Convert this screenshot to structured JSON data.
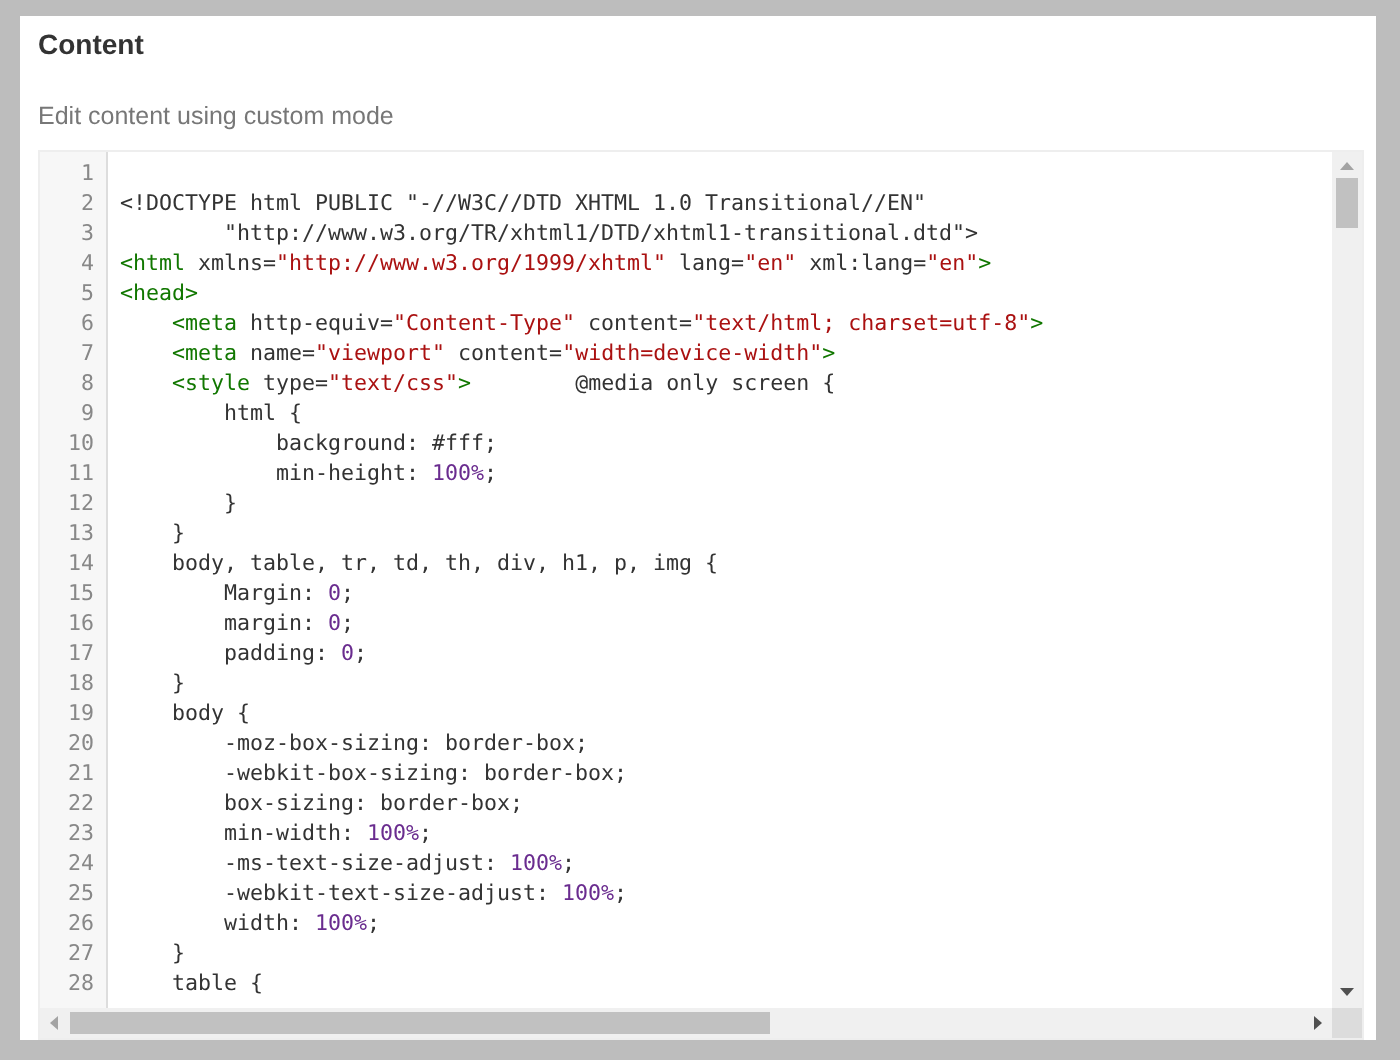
{
  "panel": {
    "title": "Content",
    "subtitle": "Edit content using custom mode"
  },
  "editor": {
    "lines": [
      {
        "number": "1"
      },
      {
        "number": "2",
        "tokens": [
          {
            "kind": "plain",
            "text": "<!DOCTYPE html PUBLIC \"-//W3C//DTD XHTML 1.0 Transitional//EN\""
          }
        ]
      },
      {
        "number": "3",
        "tokens": [
          {
            "kind": "plain",
            "text": "        \"http://www.w3.org/TR/xhtml1/DTD/xhtml1-transitional.dtd\">"
          }
        ]
      },
      {
        "number": "4",
        "tokens": [
          {
            "kind": "tag",
            "text": "<html"
          },
          {
            "kind": "attr",
            "text": " xmlns="
          },
          {
            "kind": "string",
            "text": "\"http://www.w3.org/1999/xhtml\""
          },
          {
            "kind": "attr",
            "text": " lang="
          },
          {
            "kind": "string",
            "text": "\"en\""
          },
          {
            "kind": "attr",
            "text": " xml:lang="
          },
          {
            "kind": "string",
            "text": "\"en\""
          },
          {
            "kind": "tag",
            "text": ">"
          }
        ]
      },
      {
        "number": "5",
        "tokens": [
          {
            "kind": "tag",
            "text": "<head>"
          }
        ]
      },
      {
        "number": "6",
        "tokens": [
          {
            "kind": "tag",
            "text": "    <meta"
          },
          {
            "kind": "attr",
            "text": " http-equiv="
          },
          {
            "kind": "string",
            "text": "\"Content-Type\""
          },
          {
            "kind": "attr",
            "text": " content="
          },
          {
            "kind": "string",
            "text": "\"text/html; charset=utf-8\""
          },
          {
            "kind": "tag",
            "text": ">"
          }
        ]
      },
      {
        "number": "7",
        "tokens": [
          {
            "kind": "tag",
            "text": "    <meta"
          },
          {
            "kind": "attr",
            "text": " name="
          },
          {
            "kind": "string",
            "text": "\"viewport\""
          },
          {
            "kind": "attr",
            "text": " content="
          },
          {
            "kind": "string",
            "text": "\"width=device-width\""
          },
          {
            "kind": "tag",
            "text": ">"
          }
        ]
      },
      {
        "number": "8",
        "tokens": [
          {
            "kind": "tag",
            "text": "    <style"
          },
          {
            "kind": "attr",
            "text": " type="
          },
          {
            "kind": "string",
            "text": "\"text/css\""
          },
          {
            "kind": "tag",
            "text": ">"
          },
          {
            "kind": "plain",
            "text": "        @media only screen {"
          }
        ]
      },
      {
        "number": "9",
        "tokens": [
          {
            "kind": "plain",
            "text": "        html {"
          }
        ]
      },
      {
        "number": "10",
        "tokens": [
          {
            "kind": "plain",
            "text": "            background: #fff;"
          }
        ]
      },
      {
        "number": "11",
        "tokens": [
          {
            "kind": "plain",
            "text": "            min-height: "
          },
          {
            "kind": "number",
            "text": "100%"
          },
          {
            "kind": "plain",
            "text": ";"
          }
        ]
      },
      {
        "number": "12",
        "tokens": [
          {
            "kind": "plain",
            "text": "        }"
          }
        ]
      },
      {
        "number": "13",
        "tokens": [
          {
            "kind": "plain",
            "text": "    }"
          }
        ]
      },
      {
        "number": "14",
        "tokens": [
          {
            "kind": "plain",
            "text": "    body, table, tr, td, th, div, h1, p, img {"
          }
        ]
      },
      {
        "number": "15",
        "tokens": [
          {
            "kind": "plain",
            "text": "        Margin: "
          },
          {
            "kind": "number",
            "text": "0"
          },
          {
            "kind": "plain",
            "text": ";"
          }
        ]
      },
      {
        "number": "16",
        "tokens": [
          {
            "kind": "plain",
            "text": "        margin: "
          },
          {
            "kind": "number",
            "text": "0"
          },
          {
            "kind": "plain",
            "text": ";"
          }
        ]
      },
      {
        "number": "17",
        "tokens": [
          {
            "kind": "plain",
            "text": "        padding: "
          },
          {
            "kind": "number",
            "text": "0"
          },
          {
            "kind": "plain",
            "text": ";"
          }
        ]
      },
      {
        "number": "18",
        "tokens": [
          {
            "kind": "plain",
            "text": "    }"
          }
        ]
      },
      {
        "number": "19",
        "tokens": [
          {
            "kind": "plain",
            "text": "    body {"
          }
        ]
      },
      {
        "number": "20",
        "tokens": [
          {
            "kind": "plain",
            "text": "        -moz-box-sizing: border-box;"
          }
        ]
      },
      {
        "number": "21",
        "tokens": [
          {
            "kind": "plain",
            "text": "        -webkit-box-sizing: border-box;"
          }
        ]
      },
      {
        "number": "22",
        "tokens": [
          {
            "kind": "plain",
            "text": "        box-sizing: border-box;"
          }
        ]
      },
      {
        "number": "23",
        "tokens": [
          {
            "kind": "plain",
            "text": "        min-width: "
          },
          {
            "kind": "number",
            "text": "100%"
          },
          {
            "kind": "plain",
            "text": ";"
          }
        ]
      },
      {
        "number": "24",
        "tokens": [
          {
            "kind": "plain",
            "text": "        -ms-text-size-adjust: "
          },
          {
            "kind": "number",
            "text": "100%"
          },
          {
            "kind": "plain",
            "text": ";"
          }
        ]
      },
      {
        "number": "25",
        "tokens": [
          {
            "kind": "plain",
            "text": "        -webkit-text-size-adjust: "
          },
          {
            "kind": "number",
            "text": "100%"
          },
          {
            "kind": "plain",
            "text": ";"
          }
        ]
      },
      {
        "number": "26",
        "tokens": [
          {
            "kind": "plain",
            "text": "        width: "
          },
          {
            "kind": "number",
            "text": "100%"
          },
          {
            "kind": "plain",
            "text": ";"
          }
        ]
      },
      {
        "number": "27",
        "tokens": [
          {
            "kind": "plain",
            "text": "    }"
          }
        ]
      },
      {
        "number": "28",
        "tokens": [
          {
            "kind": "plain",
            "text": "    table {"
          }
        ]
      }
    ]
  }
}
